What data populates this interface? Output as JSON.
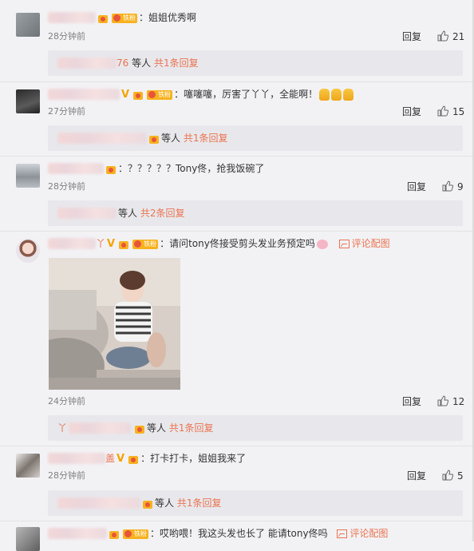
{
  "comments": [
    {
      "text": "：姐姐优秀啊",
      "time": "28分钟前",
      "reply": "回复",
      "likes": "21",
      "thread": {
        "name_suffix": "76",
        "who": "等人",
        "link": "共1条回复"
      }
    },
    {
      "text": "：噻噻噻，厉害了丫丫，全能啊！",
      "time": "27分钟前",
      "reply": "回复",
      "likes": "15",
      "thread": {
        "who": "等人",
        "link": "共1条回复"
      }
    },
    {
      "text": "：？？？？？Tony佟，抢我饭碗了",
      "time": "28分钟前",
      "reply": "回复",
      "likes": "9",
      "thread": {
        "who": "等人",
        "link": "共2条回复"
      }
    },
    {
      "text": "：请问tony佟接受剪头发业务预定吗",
      "pic_link": "评论配图",
      "name_suffix": "丫",
      "time": "24分钟前",
      "reply": "回复",
      "likes": "12",
      "thread": {
        "name_prefix": "丫",
        "who": "等人",
        "link": "共1条回复"
      }
    },
    {
      "text": "：打卡打卡，姐姐我来了",
      "name_suffix": "盖",
      "time": "28分钟前",
      "reply": "回复",
      "likes": "5",
      "thread": {
        "who": "等人",
        "link": "共1条回复"
      }
    },
    {
      "text": "：哎哟喂！我这头发也长了 能请tony佟吗",
      "pic_link": "评论配图"
    }
  ],
  "badges": {
    "fan": "铁粉"
  },
  "colors": {
    "link": "#eb7350",
    "background": "#f2f2f5",
    "reply_bar": "#e8e8ec",
    "badge": "#f7b21e"
  }
}
